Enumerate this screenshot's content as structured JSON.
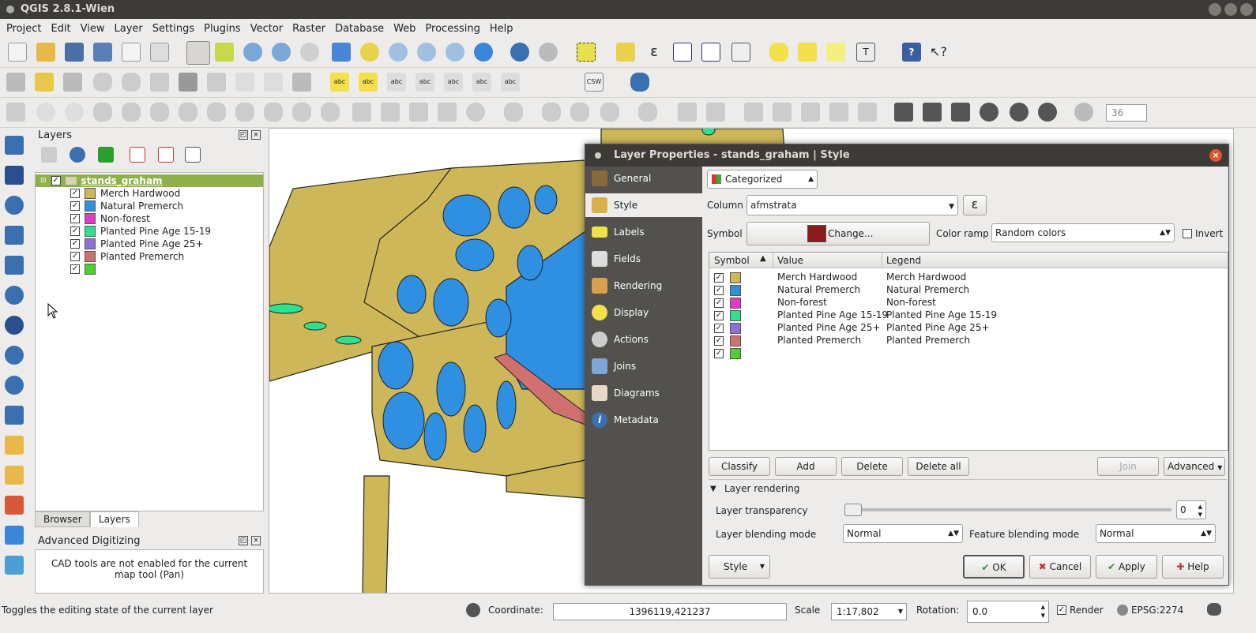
{
  "window": {
    "title": "QGIS 2.8.1-Wien"
  },
  "menu": [
    "Project",
    "Edit",
    "View",
    "Layer",
    "Settings",
    "Plugins",
    "Vector",
    "Raster",
    "Database",
    "Web",
    "Processing",
    "Help"
  ],
  "layers_panel": {
    "title": "Layers",
    "group_name": "stands_graham",
    "items": [
      {
        "label": "Merch Hardwood",
        "color": "#cdb758"
      },
      {
        "label": "Natural Premerch",
        "color": "#2f8fe0"
      },
      {
        "label": "Non-forest",
        "color": "#e03cc8"
      },
      {
        "label": "Planted Pine Age 15-19",
        "color": "#2fe08f"
      },
      {
        "label": "Planted Pine Age 25+",
        "color": "#8f6fd8"
      },
      {
        "label": "Planted Premerch",
        "color": "#d07070"
      },
      {
        "label": "",
        "color": "#4fcf2f"
      }
    ]
  },
  "tabs": {
    "browser": "Browser",
    "layers": "Layers"
  },
  "adv_digitizing": {
    "title": "Advanced Digitizing",
    "message": "CAD tools are not enabled for the current map tool (Pan)"
  },
  "dialog": {
    "title": "Layer Properties - stands_graham | Style",
    "nav": [
      "General",
      "Style",
      "Labels",
      "Fields",
      "Rendering",
      "Display",
      "Actions",
      "Joins",
      "Diagrams",
      "Metadata"
    ],
    "renderer": "Categorized",
    "column_label": "Column",
    "column_value": "afmstrata",
    "symbol_label": "Symbol",
    "symbol_button": "Change...",
    "symbol_color": "#8b1a1a",
    "color_ramp_label": "Color ramp",
    "color_ramp_value": "Random colors",
    "invert_label": "Invert",
    "table_headers": {
      "symbol": "Symbol",
      "value": "Value",
      "legend": "Legend"
    },
    "categories": [
      {
        "value": "Merch Hardwood",
        "legend": "Merch Hardwood",
        "color": "#cdb758"
      },
      {
        "value": "Natural Premerch",
        "legend": "Natural Premerch",
        "color": "#2f8fe0"
      },
      {
        "value": "Non-forest",
        "legend": "Non-forest",
        "color": "#e03cc8"
      },
      {
        "value": "Planted Pine Age 15-19",
        "legend": "Planted Pine Age 15-19",
        "color": "#2fe08f"
      },
      {
        "value": "Planted Pine Age 25+",
        "legend": "Planted Pine Age 25+",
        "color": "#8f6fd8"
      },
      {
        "value": "Planted Premerch",
        "legend": "Planted Premerch",
        "color": "#d07070"
      },
      {
        "value": "",
        "legend": "",
        "color": "#4fcf2f"
      }
    ],
    "buttons": {
      "classify": "Classify",
      "add": "Add",
      "delete": "Delete",
      "delete_all": "Delete all",
      "join": "Join",
      "advanced": "Advanced"
    },
    "layer_rendering": {
      "title": "Layer rendering",
      "transparency_label": "Layer transparency",
      "transparency_value": "0",
      "blending_label": "Layer blending mode",
      "blending_value": "Normal",
      "feature_blending_label": "Feature blending mode",
      "feature_blending_value": "Normal"
    },
    "footer": {
      "style": "Style",
      "ok": "OK",
      "cancel": "Cancel",
      "apply": "Apply",
      "help": "Help"
    }
  },
  "statusbar": {
    "message": "Toggles the editing state of the current layer",
    "coordinate_label": "Coordinate:",
    "coordinate_value": "1396119,421237",
    "scale_label": "Scale",
    "scale_value": "1:17,802",
    "rotation_label": "Rotation:",
    "rotation_value": "0.0",
    "render_label": "Render",
    "crs": "EPSG:2274"
  },
  "toolbar": {
    "label_size": "36"
  }
}
